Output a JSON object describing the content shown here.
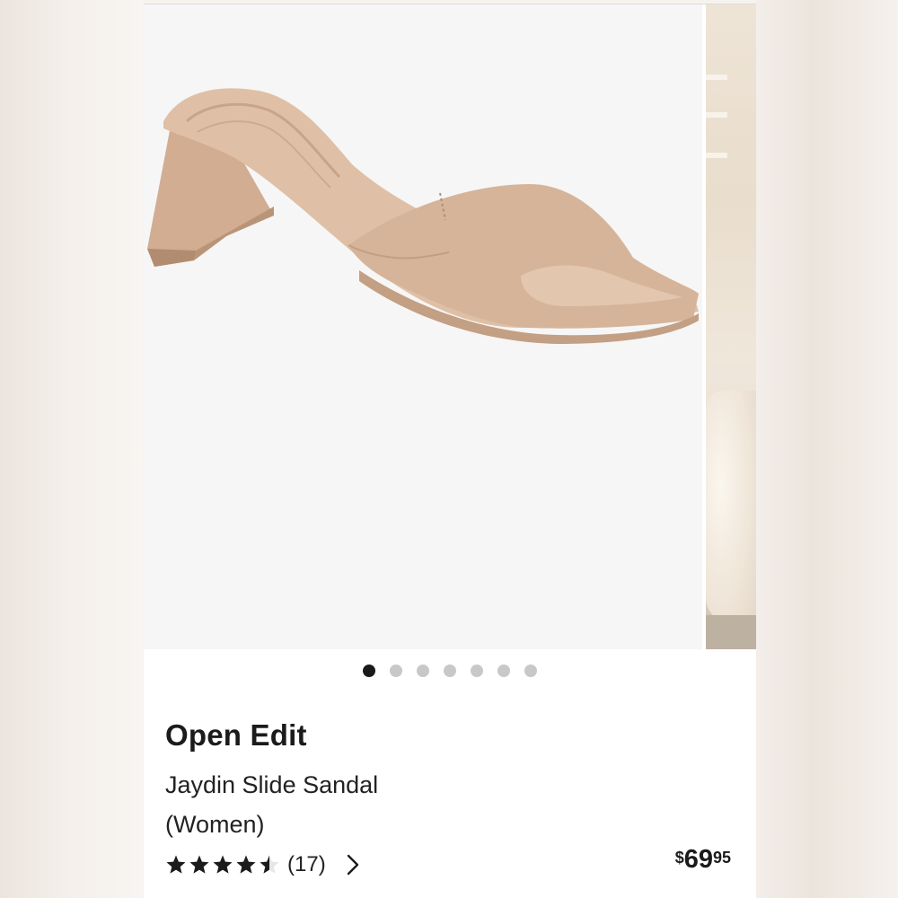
{
  "carousel": {
    "total_slides": 7,
    "active_slide": 1,
    "image_alt": "Jaydin Slide Sandal product photo"
  },
  "product": {
    "brand": "Open Edit",
    "name": "Jaydin Slide Sandal",
    "audience": "(Women)",
    "rating": 4.5,
    "review_count": "(17)",
    "price_currency": "$",
    "price_dollars": "69",
    "price_cents": "95"
  },
  "colors": {
    "sandal": "#d6b49a",
    "sandal_shadow": "#b89479",
    "text": "#1b1b1b",
    "dot_active": "#1a1a1a",
    "dot_inactive": "#c8c8c8"
  },
  "icons": {
    "star": "star-icon",
    "half_star": "half-star-icon",
    "chevron": "chevron-right-icon"
  }
}
